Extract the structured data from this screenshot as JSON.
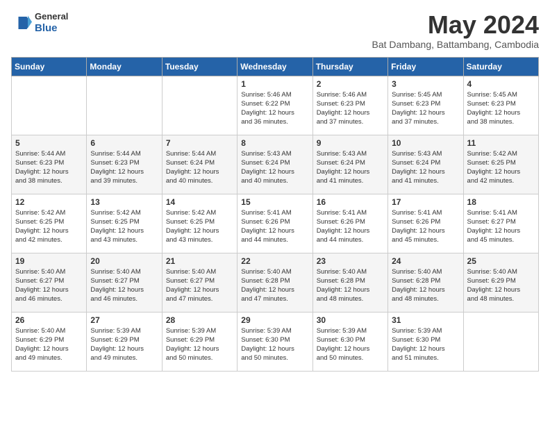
{
  "header": {
    "logo_general": "General",
    "logo_blue": "Blue",
    "month_title": "May 2024",
    "subtitle": "Bat Dambang, Battambang, Cambodia"
  },
  "days_of_week": [
    "Sunday",
    "Monday",
    "Tuesday",
    "Wednesday",
    "Thursday",
    "Friday",
    "Saturday"
  ],
  "weeks": [
    [
      {
        "day": "",
        "info": ""
      },
      {
        "day": "",
        "info": ""
      },
      {
        "day": "",
        "info": ""
      },
      {
        "day": "1",
        "info": "Sunrise: 5:46 AM\nSunset: 6:22 PM\nDaylight: 12 hours\nand 36 minutes."
      },
      {
        "day": "2",
        "info": "Sunrise: 5:46 AM\nSunset: 6:23 PM\nDaylight: 12 hours\nand 37 minutes."
      },
      {
        "day": "3",
        "info": "Sunrise: 5:45 AM\nSunset: 6:23 PM\nDaylight: 12 hours\nand 37 minutes."
      },
      {
        "day": "4",
        "info": "Sunrise: 5:45 AM\nSunset: 6:23 PM\nDaylight: 12 hours\nand 38 minutes."
      }
    ],
    [
      {
        "day": "5",
        "info": "Sunrise: 5:44 AM\nSunset: 6:23 PM\nDaylight: 12 hours\nand 38 minutes."
      },
      {
        "day": "6",
        "info": "Sunrise: 5:44 AM\nSunset: 6:23 PM\nDaylight: 12 hours\nand 39 minutes."
      },
      {
        "day": "7",
        "info": "Sunrise: 5:44 AM\nSunset: 6:24 PM\nDaylight: 12 hours\nand 40 minutes."
      },
      {
        "day": "8",
        "info": "Sunrise: 5:43 AM\nSunset: 6:24 PM\nDaylight: 12 hours\nand 40 minutes."
      },
      {
        "day": "9",
        "info": "Sunrise: 5:43 AM\nSunset: 6:24 PM\nDaylight: 12 hours\nand 41 minutes."
      },
      {
        "day": "10",
        "info": "Sunrise: 5:43 AM\nSunset: 6:24 PM\nDaylight: 12 hours\nand 41 minutes."
      },
      {
        "day": "11",
        "info": "Sunrise: 5:42 AM\nSunset: 6:25 PM\nDaylight: 12 hours\nand 42 minutes."
      }
    ],
    [
      {
        "day": "12",
        "info": "Sunrise: 5:42 AM\nSunset: 6:25 PM\nDaylight: 12 hours\nand 42 minutes."
      },
      {
        "day": "13",
        "info": "Sunrise: 5:42 AM\nSunset: 6:25 PM\nDaylight: 12 hours\nand 43 minutes."
      },
      {
        "day": "14",
        "info": "Sunrise: 5:42 AM\nSunset: 6:25 PM\nDaylight: 12 hours\nand 43 minutes."
      },
      {
        "day": "15",
        "info": "Sunrise: 5:41 AM\nSunset: 6:26 PM\nDaylight: 12 hours\nand 44 minutes."
      },
      {
        "day": "16",
        "info": "Sunrise: 5:41 AM\nSunset: 6:26 PM\nDaylight: 12 hours\nand 44 minutes."
      },
      {
        "day": "17",
        "info": "Sunrise: 5:41 AM\nSunset: 6:26 PM\nDaylight: 12 hours\nand 45 minutes."
      },
      {
        "day": "18",
        "info": "Sunrise: 5:41 AM\nSunset: 6:27 PM\nDaylight: 12 hours\nand 45 minutes."
      }
    ],
    [
      {
        "day": "19",
        "info": "Sunrise: 5:40 AM\nSunset: 6:27 PM\nDaylight: 12 hours\nand 46 minutes."
      },
      {
        "day": "20",
        "info": "Sunrise: 5:40 AM\nSunset: 6:27 PM\nDaylight: 12 hours\nand 46 minutes."
      },
      {
        "day": "21",
        "info": "Sunrise: 5:40 AM\nSunset: 6:27 PM\nDaylight: 12 hours\nand 47 minutes."
      },
      {
        "day": "22",
        "info": "Sunrise: 5:40 AM\nSunset: 6:28 PM\nDaylight: 12 hours\nand 47 minutes."
      },
      {
        "day": "23",
        "info": "Sunrise: 5:40 AM\nSunset: 6:28 PM\nDaylight: 12 hours\nand 48 minutes."
      },
      {
        "day": "24",
        "info": "Sunrise: 5:40 AM\nSunset: 6:28 PM\nDaylight: 12 hours\nand 48 minutes."
      },
      {
        "day": "25",
        "info": "Sunrise: 5:40 AM\nSunset: 6:29 PM\nDaylight: 12 hours\nand 48 minutes."
      }
    ],
    [
      {
        "day": "26",
        "info": "Sunrise: 5:40 AM\nSunset: 6:29 PM\nDaylight: 12 hours\nand 49 minutes."
      },
      {
        "day": "27",
        "info": "Sunrise: 5:39 AM\nSunset: 6:29 PM\nDaylight: 12 hours\nand 49 minutes."
      },
      {
        "day": "28",
        "info": "Sunrise: 5:39 AM\nSunset: 6:29 PM\nDaylight: 12 hours\nand 50 minutes."
      },
      {
        "day": "29",
        "info": "Sunrise: 5:39 AM\nSunset: 6:30 PM\nDaylight: 12 hours\nand 50 minutes."
      },
      {
        "day": "30",
        "info": "Sunrise: 5:39 AM\nSunset: 6:30 PM\nDaylight: 12 hours\nand 50 minutes."
      },
      {
        "day": "31",
        "info": "Sunrise: 5:39 AM\nSunset: 6:30 PM\nDaylight: 12 hours\nand 51 minutes."
      },
      {
        "day": "",
        "info": ""
      }
    ]
  ]
}
